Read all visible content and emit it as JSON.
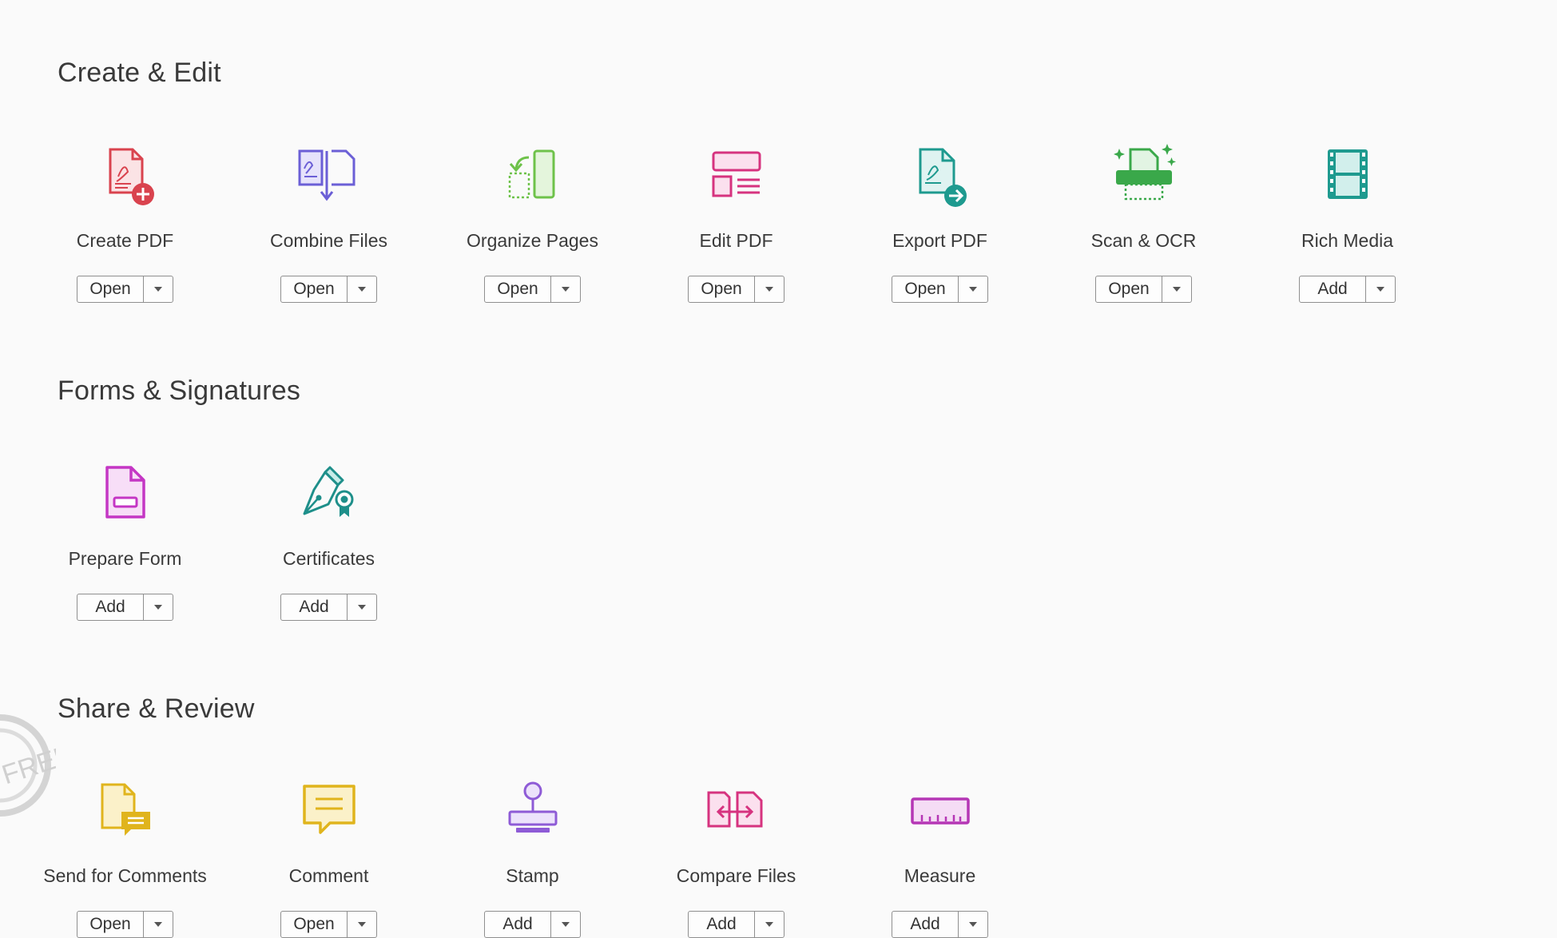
{
  "sections": [
    {
      "title": "Create & Edit",
      "tools": [
        {
          "label": "Create PDF",
          "button": "Open",
          "icon": "create-pdf-icon"
        },
        {
          "label": "Combine Files",
          "button": "Open",
          "icon": "combine-files-icon"
        },
        {
          "label": "Organize Pages",
          "button": "Open",
          "icon": "organize-pages-icon"
        },
        {
          "label": "Edit PDF",
          "button": "Open",
          "icon": "edit-pdf-icon"
        },
        {
          "label": "Export PDF",
          "button": "Open",
          "icon": "export-pdf-icon"
        },
        {
          "label": "Scan & OCR",
          "button": "Open",
          "icon": "scan-ocr-icon"
        },
        {
          "label": "Rich Media",
          "button": "Add",
          "icon": "rich-media-icon"
        }
      ]
    },
    {
      "title": "Forms & Signatures",
      "tools": [
        {
          "label": "Prepare Form",
          "button": "Add",
          "icon": "prepare-form-icon"
        },
        {
          "label": "Certificates",
          "button": "Add",
          "icon": "certificates-icon"
        }
      ]
    },
    {
      "title": "Share & Review",
      "tools": [
        {
          "label": "Send for Comments",
          "button": "Open",
          "icon": "send-for-comments-icon"
        },
        {
          "label": "Comment",
          "button": "Open",
          "icon": "comment-icon"
        },
        {
          "label": "Stamp",
          "button": "Add",
          "icon": "stamp-icon"
        },
        {
          "label": "Compare Files",
          "button": "Add",
          "icon": "compare-files-icon"
        },
        {
          "label": "Measure",
          "button": "Add",
          "icon": "measure-icon"
        }
      ]
    }
  ],
  "watermark_text": "FREE",
  "colors": {
    "background": "#fafafa",
    "create_pdf": "#d9434e",
    "combine_files": "#6b5fd6",
    "organize_pages": "#6ec24a",
    "edit_pdf": "#d6337f",
    "export_pdf": "#1e9a8f",
    "scan_ocr": "#3aa84a",
    "rich_media": "#1e9a8f",
    "prepare_form": "#c436c4",
    "certificates": "#1e8f8a",
    "send_for_comments": "#e0b41c",
    "comment": "#e0b41c",
    "stamp": "#8e5bd6",
    "compare_files": "#d6337f",
    "measure": "#b536b5"
  }
}
